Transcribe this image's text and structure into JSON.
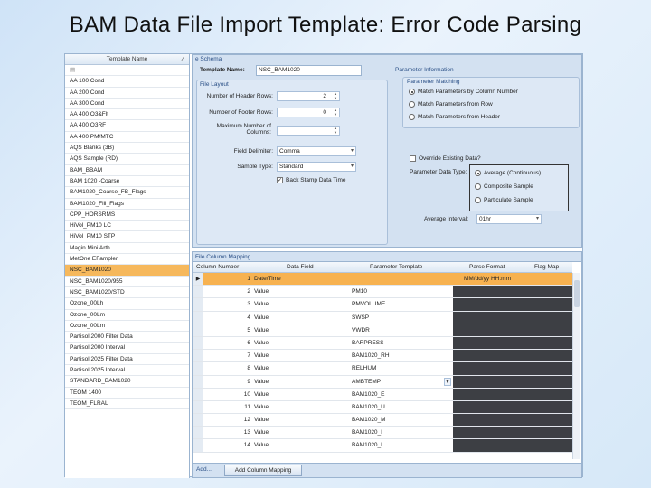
{
  "slide_title": "BAM Data File Import Template: Error Code Parsing",
  "left_panel": {
    "header": "Template Name",
    "sort_icon": "sort-indicator",
    "icon_row": "▤",
    "items": [
      "AA 100 Cond",
      "AA 200 Cond",
      "AA 300 Cond",
      "AA 400 O3&Flt",
      "AA 400 O3RF",
      "AA 400 PM/MTC",
      "AQS Blanks (3B)",
      "AQS Sample (RD)",
      "BAM_BBAM",
      "BAM 1020 -Coarse",
      "BAM1020_Coarse_FB_Flags",
      "BAM1020_Fill_Flags",
      "CPP_HORSRMS",
      "HiVol_PM10 LC",
      "HiVol_PM10 STP",
      "Magin Mini Arth",
      "MetOne EFampler",
      "NSC_BAM1020",
      "NSC_BAM1020/955",
      "NSC_BAM1020/STD",
      "Ozone_00Lh",
      "Ozone_00Lm",
      "Ozone_00Lm",
      "Partisol 2000 Filter Data",
      "Partisol 2000 Interval",
      "Partisol 2025 Filter Data",
      "Partisol 2025 Interval",
      "STANDARD_BAM1020",
      "TEOM 1400",
      "TEOM_FLRAL"
    ],
    "selected_index": 17
  },
  "schema": {
    "label": "e Schema",
    "template_name_label": "Template Name:",
    "template_name_value": "NSC_BAM1020",
    "file_layout": {
      "label": "File Layout",
      "num_header_rows_label": "Number of Header Rows:",
      "num_header_rows_value": "2",
      "num_footer_rows_label": "Number of Footer Rows:",
      "num_footer_rows_value": "0",
      "max_columns_label": "Maximum Number of Columns:",
      "max_columns_value": "",
      "field_delimiter_label": "Field Delimiter:",
      "field_delimiter_value": "Comma",
      "sample_type_label": "Sample Type:",
      "sample_type_value": "Standard",
      "back_stamp_label": "Back Stamp Data Time",
      "back_stamp_checked": true
    },
    "parameter_information": {
      "label": "Parameter Information",
      "matching_label": "Parameter Matching",
      "options": [
        "Match Parameters by Column Number",
        "Match Parameters from Row",
        "Match Parameters from Header"
      ],
      "selected_option": 0,
      "override_label": "Override Existing Data?",
      "override_checked": false,
      "data_type_label": "Parameter Data Type:",
      "data_type_options": [
        "Average (Continuous)",
        "Composite Sample",
        "Particulate Sample"
      ],
      "data_type_selected": 0,
      "avg_interval_label": "Average Interval:",
      "avg_interval_value": "01hr"
    }
  },
  "mapping": {
    "title": "File Column Mapping",
    "columns": [
      "Column Number",
      "Data Field",
      "Parameter Template",
      "Parse Format",
      "Flag Map"
    ],
    "rows": [
      {
        "num": "1",
        "field": "Date/Time",
        "param": "",
        "fmt": "MM/dd/yy HH:mm",
        "selected": true
      },
      {
        "num": "2",
        "field": "Value",
        "param": "PM10",
        "fmt": ""
      },
      {
        "num": "3",
        "field": "Value",
        "param": "PMVOLUME",
        "fmt": ""
      },
      {
        "num": "4",
        "field": "Value",
        "param": "SWSP",
        "fmt": ""
      },
      {
        "num": "5",
        "field": "Value",
        "param": "VWDR",
        "fmt": ""
      },
      {
        "num": "6",
        "field": "Value",
        "param": "BARPRESS",
        "fmt": ""
      },
      {
        "num": "7",
        "field": "Value",
        "param": "BAM1020_RH",
        "fmt": ""
      },
      {
        "num": "8",
        "field": "Value",
        "param": "RELHUM",
        "fmt": ""
      },
      {
        "num": "9",
        "field": "Value",
        "param": "AMBTEMP",
        "fmt": "",
        "dropdown": true
      },
      {
        "num": "10",
        "field": "Value",
        "param": "BAM1020_E",
        "fmt": ""
      },
      {
        "num": "11",
        "field": "Value",
        "param": "BAM1020_U",
        "fmt": ""
      },
      {
        "num": "12",
        "field": "Value",
        "param": "BAM1020_M",
        "fmt": ""
      },
      {
        "num": "13",
        "field": "Value",
        "param": "BAM1020_I",
        "fmt": ""
      },
      {
        "num": "14",
        "field": "Value",
        "param": "BAM1020_L",
        "fmt": ""
      }
    ],
    "add_label": "Add...",
    "add_mapping_label": "Add Column Mapping"
  }
}
